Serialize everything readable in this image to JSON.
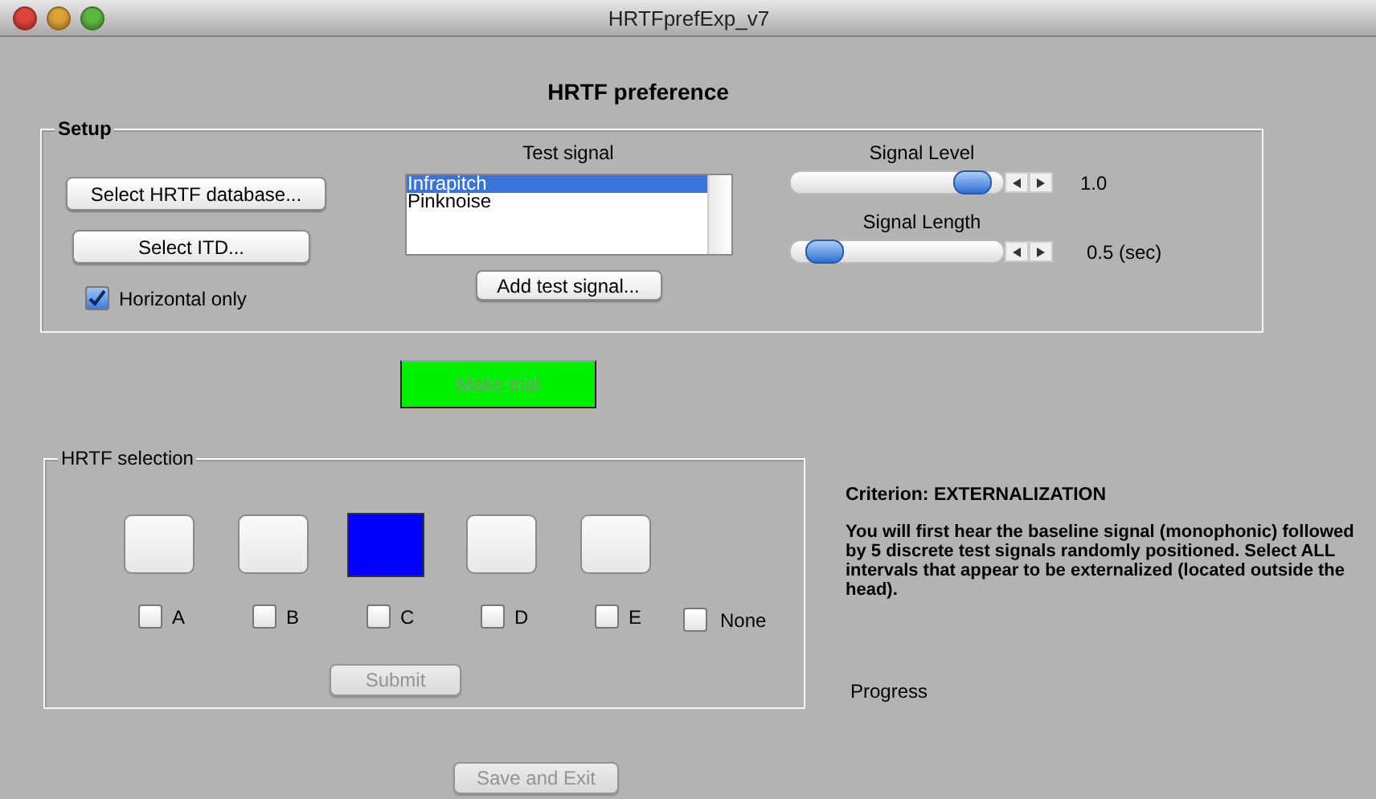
{
  "window": {
    "title": "HRTFprefExp_v7"
  },
  "heading": "HRTF preference",
  "setup": {
    "legend": "Setup",
    "buttons": [
      "Select HRTF database...",
      "Select ITD..."
    ],
    "horizontal_only": {
      "label": "Horizontal only",
      "checked": true
    },
    "test_signal": {
      "label": "Test signal",
      "items": [
        {
          "label": "Infrapitch",
          "selected": true
        },
        {
          "label": "Pinknoise",
          "selected": false
        }
      ],
      "add_button": "Add test signal..."
    },
    "sliders": [
      {
        "label": "Signal Level",
        "level": 0.92,
        "reading": "1.0"
      },
      {
        "label": "Signal Length",
        "level": 0.08,
        "reading": "0.5 (sec)"
      }
    ]
  },
  "make_trial": {
    "label": "Make trial",
    "disabled": true
  },
  "selection": {
    "legend": "HRTF selection",
    "intervals": [
      {
        "label": "A",
        "selected": false,
        "checked": false
      },
      {
        "label": "B",
        "selected": false,
        "checked": false
      },
      {
        "label": "C",
        "selected": true,
        "checked": false
      },
      {
        "label": "D",
        "selected": false,
        "checked": false
      },
      {
        "label": "E",
        "selected": false,
        "checked": false
      }
    ],
    "none": {
      "label": "None",
      "checked": false
    },
    "submit": {
      "label": "Submit",
      "disabled": true
    }
  },
  "criterion": {
    "title": "Criterion: EXTERNALIZATION",
    "text": "You will first hear the baseline signal (monophonic) followed by 5 discrete test signals randomly positioned. Select ALL intervals that appear to be externalized (located outside the head)."
  },
  "progress": "Progress",
  "save_exit": {
    "label": "Save and Exit",
    "disabled": true
  }
}
